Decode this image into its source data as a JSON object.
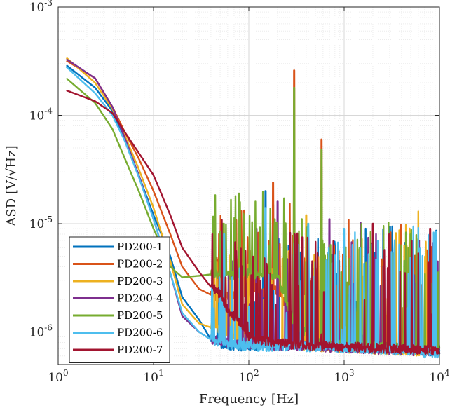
{
  "chart_data": {
    "type": "line",
    "title": "",
    "xlabel": "Frequency [Hz]",
    "ylabel": "ASD [V/√Hz]",
    "xscale": "log",
    "yscale": "log",
    "xlim": [
      1,
      10000
    ],
    "ylim": [
      5e-07,
      0.001
    ],
    "grid": true,
    "legend_position": "bottom-left",
    "x_tick_labels": [
      "10^0",
      "10^1",
      "10^2",
      "10^3",
      "10^4"
    ],
    "y_tick_labels": [
      "10^-6",
      "10^-5",
      "10^-4",
      "10^-3"
    ],
    "x_ticks": [
      1,
      10,
      100,
      1000,
      10000
    ],
    "y_ticks": [
      1e-06,
      1e-05,
      0.0001,
      0.001
    ],
    "series": [
      {
        "name": "PD200-1",
        "color": "#0072BD",
        "x": [
          1.22,
          2.44,
          3.7,
          5,
          7,
          10,
          15,
          20,
          30,
          40,
          50,
          55,
          60,
          80,
          100,
          150,
          200,
          300,
          500,
          1000,
          2000,
          5000,
          10000
        ],
        "y": [
          0.00029,
          0.00018,
          0.00011,
          6e-05,
          2.8e-05,
          1.2e-05,
          5e-06,
          2.1e-06,
          1.3e-06,
          8.5e-07,
          7.8e-07,
          7.5e-07,
          7.4e-07,
          7.3e-07,
          7.2e-07,
          7.5e-07,
          7.4e-07,
          7.5e-07,
          7.4e-07,
          7.2e-07,
          7e-07,
          6.8e-07,
          6.5e-07
        ],
        "peaks": [
          [
            50,
            8e-06
          ],
          [
            150,
            2e-05
          ],
          [
            180,
            1.5e-05
          ]
        ]
      },
      {
        "name": "PD200-2",
        "color": "#D95319",
        "x": [
          1.22,
          2.44,
          3.7,
          5,
          7,
          10,
          15,
          20,
          30,
          40,
          50,
          60,
          80,
          100,
          150,
          200,
          300,
          500,
          1000,
          2000,
          5000,
          10000
        ],
        "y": [
          0.00032,
          0.00022,
          0.00012,
          7e-05,
          4e-05,
          2e-05,
          8e-06,
          4e-06,
          2.5e-06,
          2.2e-06,
          2e-06,
          2.1e-06,
          2.3e-06,
          2.2e-06,
          2.3e-06,
          2.4e-06,
          1.2e-06,
          9e-07,
          8e-07,
          7.5e-07,
          7e-07,
          6.8e-07
        ],
        "peaks": [
          [
            300,
            0.00026
          ],
          [
            580,
            6e-05
          ],
          [
            180,
            2.4e-05
          ]
        ]
      },
      {
        "name": "PD200-3",
        "color": "#EDB120",
        "x": [
          1.22,
          2.44,
          3.7,
          5,
          7,
          10,
          15,
          20,
          30,
          40,
          50,
          60,
          80,
          100,
          150,
          200,
          300,
          500,
          1000,
          2000,
          5000,
          10000
        ],
        "y": [
          0.00034,
          0.0002,
          0.000115,
          6.5e-05,
          3.2e-05,
          1.4e-05,
          4.5e-06,
          1.8e-06,
          1.2e-06,
          1.1e-06,
          1.05e-06,
          9e-07,
          8e-07,
          7.8e-07,
          7.6e-07,
          7.4e-07,
          7.5e-07,
          7.2e-07,
          7e-07,
          6.8e-07,
          6.6e-07,
          6.5e-07
        ],
        "peaks": [
          [
            80,
            1.6e-05
          ],
          [
            400,
            1.2e-05
          ],
          [
            6000,
            1.3e-05
          ]
        ]
      },
      {
        "name": "PD200-4",
        "color": "#7E2F8E",
        "x": [
          1.22,
          2.44,
          3.7,
          5,
          7,
          10,
          15,
          20,
          30,
          40,
          50,
          60,
          80,
          100,
          150,
          200,
          300,
          500,
          1000,
          2000,
          5000,
          10000
        ],
        "y": [
          0.00033,
          0.00022,
          0.00012,
          6.2e-05,
          2.8e-05,
          1.1e-05,
          3.5e-06,
          1.4e-06,
          1e-06,
          8.5e-07,
          8e-07,
          7.8e-07,
          7.6e-07,
          7.4e-07,
          7.5e-07,
          7.2e-07,
          7.4e-07,
          7.2e-07,
          7e-07,
          6.8e-07,
          6.6e-07,
          6.5e-07
        ],
        "peaks": [
          [
            120,
            9e-06
          ],
          [
            200,
            1.6e-05
          ],
          [
            700,
            1.1e-05
          ]
        ]
      },
      {
        "name": "PD200-5",
        "color": "#77AC30",
        "x": [
          1.22,
          2.44,
          3.7,
          5,
          7,
          10,
          15,
          20,
          30,
          40,
          50,
          60,
          80,
          100,
          150,
          200,
          300,
          500,
          1000,
          2000,
          5000,
          10000
        ],
        "y": [
          0.00022,
          0.00013,
          7.5e-05,
          4e-05,
          2e-05,
          9e-06,
          4e-06,
          3.2e-06,
          3.3e-06,
          3.4e-06,
          3.4e-06,
          3.3e-06,
          3.3e-06,
          3.4e-06,
          3.3e-06,
          3.2e-06,
          1.2e-06,
          8e-07,
          7.5e-07,
          7.2e-07,
          7e-07,
          6.8e-07
        ],
        "peaks": [
          [
            300,
            0.00018
          ],
          [
            580,
            4.8e-05
          ],
          [
            50,
            8.5e-06
          ],
          [
            80,
            8e-06
          ]
        ]
      },
      {
        "name": "PD200-6",
        "color": "#4DBEEE",
        "x": [
          1.22,
          2.44,
          3.7,
          5,
          7,
          10,
          15,
          20,
          30,
          40,
          50,
          60,
          80,
          100,
          150,
          200,
          300,
          500,
          1000,
          2000,
          5000,
          10000
        ],
        "y": [
          0.00028,
          0.00016,
          0.0001,
          5.8e-05,
          2.7e-05,
          1.1e-05,
          3.5e-06,
          1.5e-06,
          1e-06,
          8.5e-07,
          7.8e-07,
          7.6e-07,
          7.4e-07,
          7.3e-07,
          7.2e-07,
          7.3e-07,
          7.2e-07,
          7.1e-07,
          7e-07,
          6.8e-07,
          6.6e-07,
          6.2e-07
        ],
        "peaks": [
          [
            55,
            8e-06
          ],
          [
            150,
            1.4e-05
          ],
          [
            420,
            1e-05
          ],
          [
            1000,
            9e-06
          ]
        ]
      },
      {
        "name": "PD200-7",
        "color": "#A2142F",
        "x": [
          1.22,
          2.44,
          3.7,
          5,
          7,
          10,
          15,
          20,
          30,
          40,
          50,
          60,
          80,
          100,
          150,
          200,
          300,
          500,
          1000,
          2000,
          5000,
          10000
        ],
        "y": [
          0.00017,
          0.000135,
          0.000105,
          7e-05,
          4.5e-05,
          2.8e-05,
          1.2e-05,
          6e-06,
          3.6e-06,
          2.6e-06,
          2.2e-06,
          1.6e-06,
          1.2e-06,
          9e-07,
          8e-07,
          7.8e-07,
          7.5e-07,
          7.4e-07,
          7.2e-07,
          7e-07,
          6.8e-07,
          6.6e-07
        ],
        "peaks": [
          [
            2000,
            1e-05
          ],
          [
            3000,
            8e-06
          ],
          [
            8000,
            9e-06
          ]
        ]
      }
    ]
  }
}
